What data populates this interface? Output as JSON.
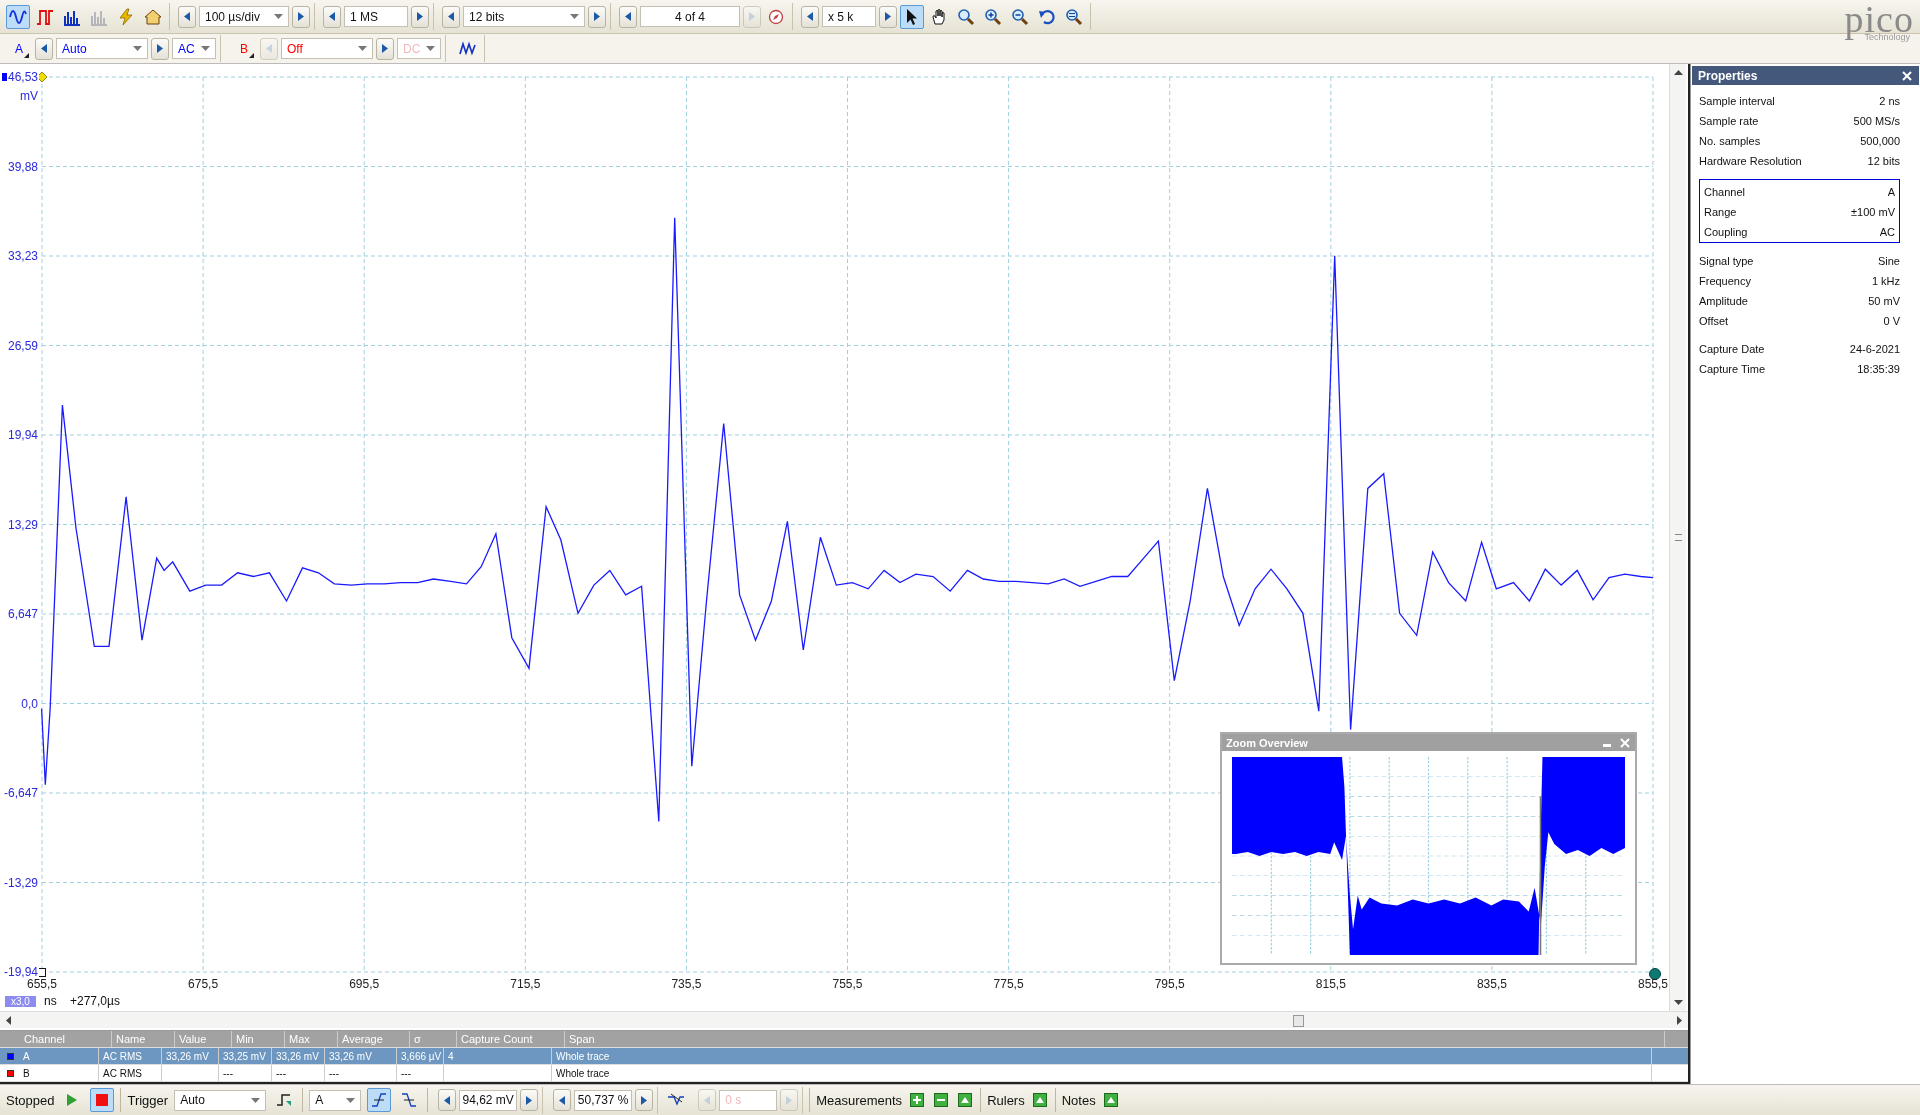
{
  "toolbar": {
    "views": [
      {
        "kind": "scope",
        "selected": true,
        "disabled": false
      },
      {
        "kind": "persistence",
        "selected": false,
        "disabled": false
      },
      {
        "kind": "spectrum",
        "selected": false,
        "disabled": false
      },
      {
        "kind": "spectrum_persistence",
        "selected": false,
        "disabled": true
      },
      {
        "kind": "auto_setup",
        "selected": false,
        "disabled": false
      },
      {
        "kind": "home",
        "selected": false,
        "disabled": false
      }
    ],
    "timebase": "100 µs/div",
    "samples": "1 MS",
    "resolution": "12 bits",
    "buffer": "4 of 4",
    "zoom": "x 5 k",
    "tools": [
      {
        "kind": "pointer",
        "selected": true
      },
      {
        "kind": "hand",
        "selected": false
      },
      {
        "kind": "zoom_rect",
        "selected": false
      },
      {
        "kind": "zoom_in",
        "selected": false
      },
      {
        "kind": "zoom_out",
        "selected": false
      },
      {
        "kind": "undo",
        "selected": false
      },
      {
        "kind": "zoom_full",
        "selected": false
      }
    ]
  },
  "logo": {
    "name": "pico",
    "tagline": "Technology"
  },
  "channels": [
    {
      "label": "A",
      "range": "Auto",
      "coupling": "AC",
      "enabled": true,
      "color": "#0000ff"
    },
    {
      "label": "B",
      "range": "Off",
      "coupling": "DC",
      "enabled": false,
      "color": "#ff0000"
    }
  ],
  "chart": {
    "y_unit": "mV",
    "yticks": [
      "46,53",
      "39,88",
      "33,23",
      "26,59",
      "19,94",
      "13,29",
      "6,647",
      "0,0",
      "-6,647",
      "-13,29",
      "-19,94"
    ],
    "xticks": [
      "655,5",
      "675,5",
      "695,5",
      "715,5",
      "735,5",
      "755,5",
      "775,5",
      "795,5",
      "815,5",
      "835,5",
      "855,5"
    ],
    "zoom_factor": "x3,0",
    "x_unit": "ns",
    "offset": "+277,0µs"
  },
  "zoom_overview": {
    "title": "Zoom Overview"
  },
  "properties": {
    "title": "Properties",
    "sections": [
      {
        "boxed": false,
        "rows": [
          {
            "label": "Sample interval",
            "value": "2 ns"
          },
          {
            "label": "Sample rate",
            "value": "500 MS/s"
          },
          {
            "label": "No. samples",
            "value": "500,000"
          },
          {
            "label": "Hardware Resolution",
            "value": "12 bits"
          }
        ]
      },
      {
        "boxed": true,
        "rows": [
          {
            "label": "Channel",
            "value": "A"
          },
          {
            "label": "Range",
            "value": "±100 mV"
          },
          {
            "label": "Coupling",
            "value": "AC"
          }
        ]
      },
      {
        "boxed": false,
        "rows": [
          {
            "label": "Signal type",
            "value": "Sine"
          },
          {
            "label": "Frequency",
            "value": "1 kHz"
          },
          {
            "label": "Amplitude",
            "value": "50 mV"
          },
          {
            "label": "Offset",
            "value": "0 V"
          }
        ]
      },
      {
        "boxed": false,
        "rows": [
          {
            "label": "Capture Date",
            "value": "24-6-2021"
          },
          {
            "label": "Capture Time",
            "value": "18:35:39"
          }
        ]
      }
    ]
  },
  "measurements": {
    "columns": [
      "Channel",
      "Name",
      "Value",
      "Min",
      "Max",
      "Average",
      "σ",
      "Capture Count",
      "Span"
    ],
    "rows": [
      {
        "color": "#0000ff",
        "selected": true,
        "cells": [
          "A",
          "AC RMS",
          "33,26 mV",
          "33,25 mV",
          "33,26 mV",
          "33,26 mV",
          "3,666 µV",
          "4",
          "Whole trace"
        ]
      },
      {
        "color": "#ff0000",
        "selected": false,
        "cells": [
          "B",
          "AC RMS",
          null,
          "---",
          "---",
          "---",
          "---",
          null,
          "Whole trace"
        ]
      }
    ]
  },
  "status": {
    "state": "Stopped",
    "running": false,
    "trigger": {
      "label": "Trigger",
      "mode": "Auto",
      "channel": "A",
      "edges": [
        {
          "kind": "rising",
          "selected": true
        },
        {
          "kind": "falling",
          "selected": false
        }
      ],
      "threshold": "94,62 mV",
      "pretrigger": "50,737 %",
      "delay": "0 s",
      "delay_enabled": false
    },
    "panels": [
      {
        "label": "Measurements",
        "actions": [
          {
            "kind": "add"
          },
          {
            "kind": "remove"
          },
          {
            "kind": "open"
          }
        ]
      },
      {
        "label": "Rulers",
        "actions": [
          {
            "kind": "open"
          }
        ]
      },
      {
        "label": "Notes",
        "actions": [
          {
            "kind": "open"
          }
        ]
      }
    ]
  }
}
